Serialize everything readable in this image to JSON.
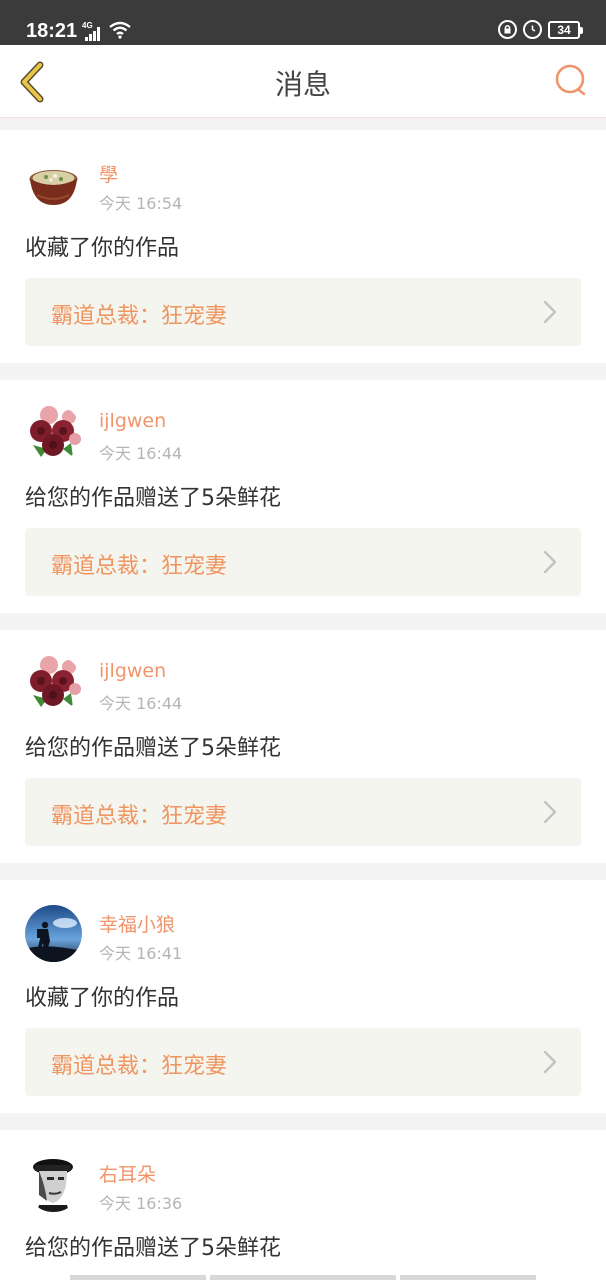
{
  "status": {
    "time": "18:21",
    "network": "4G",
    "battery": "34"
  },
  "nav": {
    "title": "消息",
    "back_icon": "chevron-left-icon",
    "search_icon": "search-icon"
  },
  "colors": {
    "accent": "#f0956a",
    "back_icon": "#e8c64a",
    "work_bg": "#f5f5ef"
  },
  "messages": [
    {
      "user": "學",
      "time": "今天 16:54",
      "action": "收藏了你的作品",
      "work": "霸道总裁：狂宠妻",
      "avatar": "soup-bowl-avatar"
    },
    {
      "user": "ijlgwen",
      "time": "今天 16:44",
      "action": "给您的作品赠送了5朵鲜花",
      "work": "霸道总裁：狂宠妻",
      "avatar": "roses-avatar"
    },
    {
      "user": "ijlgwen",
      "time": "今天 16:44",
      "action": "给您的作品赠送了5朵鲜花",
      "work": "霸道总裁：狂宠妻",
      "avatar": "roses-avatar"
    },
    {
      "user": "幸福小狼",
      "time": "今天 16:41",
      "action": "收藏了你的作品",
      "work": "霸道总裁：狂宠妻",
      "avatar": "hiker-avatar"
    },
    {
      "user": "右耳朵",
      "time": "今天 16:36",
      "action": "给您的作品赠送了5朵鲜花",
      "work": "",
      "avatar": "man-portrait-avatar"
    }
  ]
}
